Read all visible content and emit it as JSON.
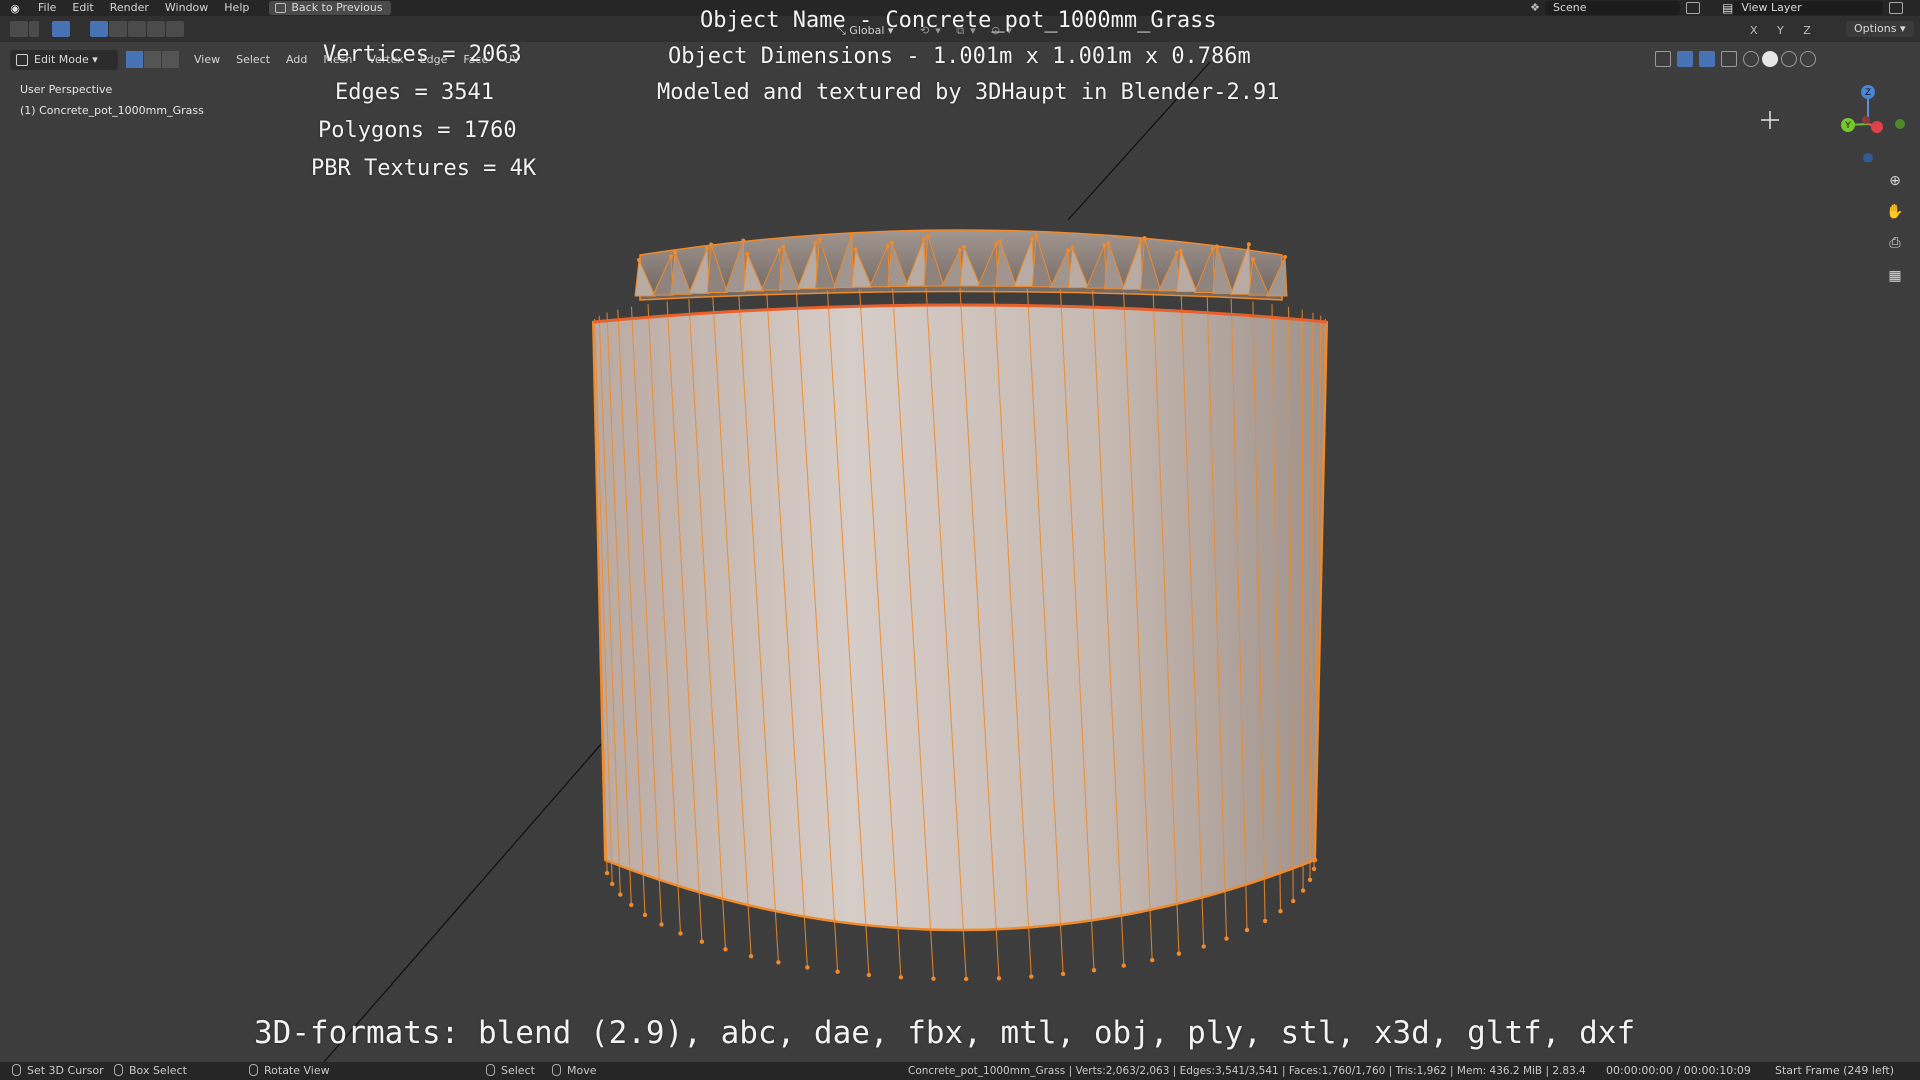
{
  "menubar": {
    "items": [
      "File",
      "Edit",
      "Render",
      "Window",
      "Help"
    ],
    "back_button": "Back to Previous",
    "scene": "Scene",
    "view_layer": "View Layer"
  },
  "toolbar": {
    "orientation": "Global",
    "axes": "X Y Z",
    "options": "Options"
  },
  "header": {
    "mode": "Edit Mode",
    "menus": [
      "View",
      "Select",
      "Add",
      "Mesh",
      "Vertex",
      "Edge",
      "Face",
      "UV"
    ]
  },
  "viewport": {
    "perspective": "User Perspective",
    "object_label": "(1) Concrete_pot_1000mm_Grass"
  },
  "overlay": {
    "vertices": "Vertices = 2063",
    "edges": "Edges = 3541",
    "polygons": "Polygons = 1760",
    "pbr": "PBR Textures = 4K",
    "object_name": "Object Name - Concrete_pot_1000mm_Grass",
    "object_dimensions": "Object Dimensions -  1.001m x 1.001m x 0.786m",
    "modeled_by": "Modeled and textured by 3DHaupt in Blender-2.91",
    "formats": "3D-formats: blend (2.9), abc, dae, fbx, mtl, obj, ply, stl, x3d, gltf, dxf"
  },
  "gizmo": {
    "x": "X",
    "y": "Y",
    "z": "Z"
  },
  "statusbar": {
    "set_cursor": "Set 3D Cursor",
    "box_select": "Box Select",
    "rotate_view": "Rotate View",
    "select": "Select",
    "move": "Move",
    "stats": "Concrete_pot_1000mm_Grass | Verts:2,063/2,063 | Edges:3,541/3,541 | Faces:1,760/1,760 | Tris:1,962 | Mem: 436.2 MiB | 2.83.4",
    "time": "00:00:00:00 / 00:00:10:09",
    "start_frame": "Start Frame (249 left)"
  },
  "colors": {
    "background": "#3d3d3d",
    "mesh_edge": "#f08a2a",
    "accent_blue": "#4772b3"
  }
}
